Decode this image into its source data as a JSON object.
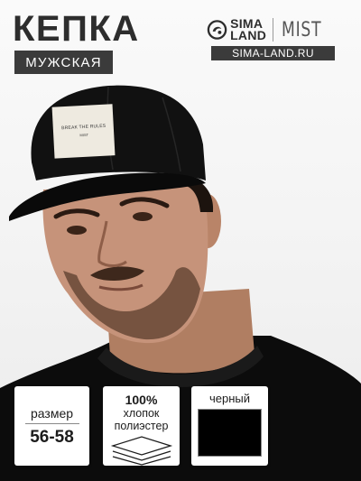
{
  "header": {
    "title": "КЕПКА",
    "subtitle": "МУЖСКАЯ"
  },
  "brand": {
    "name_line1": "SIMA",
    "name_line2": "LAND",
    "sub_brand": "MIST",
    "website": "SIMA-LAND.RU",
    "logo_icon": "sima-land-swirl-icon"
  },
  "cap_patch": {
    "line1": "BREAK THE RULES",
    "line2": "MIST"
  },
  "specs": {
    "size": {
      "label": "размер",
      "value": "56-58"
    },
    "material": {
      "percent": "100%",
      "line1": "хлопок",
      "line2": "полиэстер",
      "icon": "fabric-layers-icon"
    },
    "color": {
      "label": "черный",
      "swatch_hex": "#000000"
    }
  },
  "colors": {
    "badge_bg": "#3b3b3b",
    "title_text": "#2d2d2d",
    "card_bg": "#ffffff"
  }
}
